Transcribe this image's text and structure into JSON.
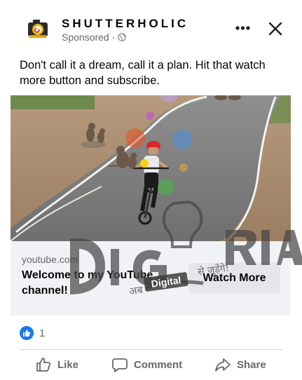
{
  "header": {
    "page_name": "SHUTTERHOLIC",
    "sponsored": "Sponsored",
    "separator": "·"
  },
  "post": {
    "text": "Don't call it a dream, call it a plan. Hit that watch more button and subscribe."
  },
  "link_preview": {
    "domain": "youtube.com",
    "title": "Welcome to my YouTube channel!",
    "cta_label": "Watch More"
  },
  "watermark": {
    "brand": "DIGITORIA",
    "tagline_left": "अब",
    "tagline_badge": "Digital",
    "tagline_right": "से जुड़ेंगे!"
  },
  "reactions": {
    "count": "1"
  },
  "actions": {
    "like": "Like",
    "comment": "Comment",
    "share": "Share"
  },
  "colors": {
    "facebook_blue": "#1877f2",
    "secondary_text": "#65676b",
    "link_bar_bg": "#f0f2f5",
    "button_bg": "#e4e6eb"
  },
  "icons": [
    "shutterholic-logo",
    "globe-icon",
    "more-options-icon",
    "close-icon",
    "like-reaction-icon",
    "like-icon",
    "comment-icon",
    "share-icon"
  ]
}
